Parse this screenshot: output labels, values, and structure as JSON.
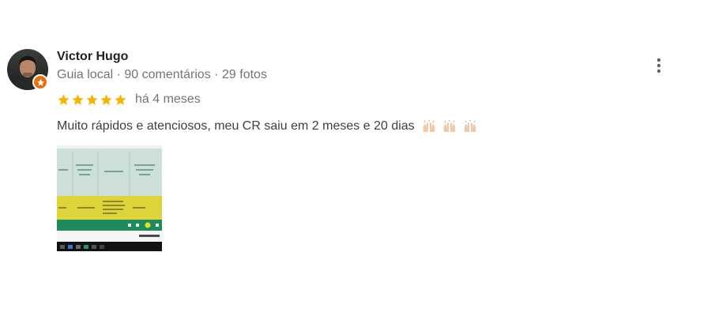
{
  "review": {
    "author_name": "Victor Hugo",
    "author_role": "Guia local",
    "author_reviews": "90 comentários",
    "author_photos": "29 fotos",
    "separator": "·",
    "rating": 5,
    "rating_max": 5,
    "star_color": "#f5b400",
    "timestamp": "há 4 meses",
    "text": "Muito rápidos e atenciosos, meu CR saiu em 2 meses e 20 dias",
    "emoji": [
      "raising-hands-emoji",
      "raising-hands-emoji",
      "raising-hands-emoji"
    ],
    "badge_color": "#e8710a",
    "photo_count": 1
  },
  "icons": {
    "more": "more-vert-icon",
    "badge": "local-guide-star-icon"
  }
}
